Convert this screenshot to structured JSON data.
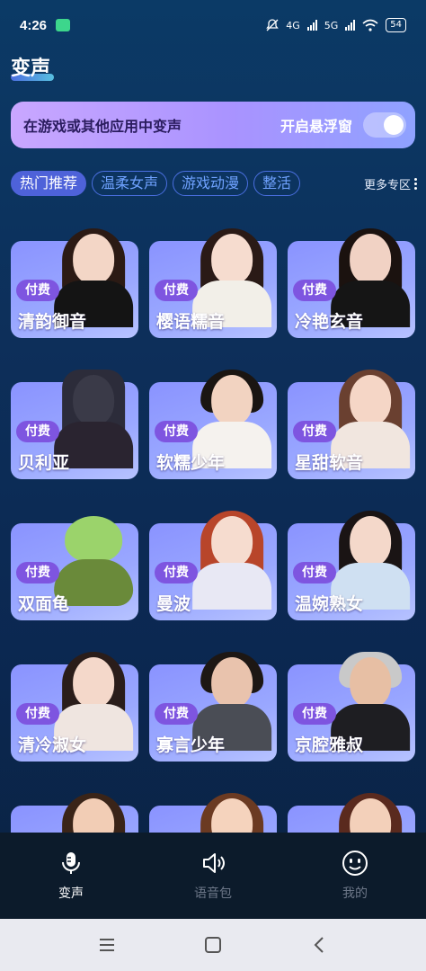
{
  "status_bar": {
    "time": "4:26",
    "signal_1": "4G",
    "signal_2": "5G",
    "battery": "54"
  },
  "header": {
    "title": "变声"
  },
  "float_banner": {
    "text": "在游戏或其他应用中变声",
    "toggle_label": "开启悬浮窗",
    "toggle_on": false
  },
  "tabs": {
    "items": [
      "热门推荐",
      "温柔女声",
      "游戏动漫",
      "整活"
    ],
    "active": "热门推荐",
    "more_label": "更多专区"
  },
  "voices": [
    {
      "name": "清韵御音",
      "badge": "付费"
    },
    {
      "name": "樱语糯音",
      "badge": "付费"
    },
    {
      "name": "冷艳玄音",
      "badge": "付费"
    },
    {
      "name": "贝利亚",
      "badge": "付费"
    },
    {
      "name": "软糯少年",
      "badge": "付费"
    },
    {
      "name": "星甜软音",
      "badge": "付费"
    },
    {
      "name": "双面龟",
      "badge": "付费"
    },
    {
      "name": "曼波",
      "badge": "付费"
    },
    {
      "name": "温婉熟女",
      "badge": "付费"
    },
    {
      "name": "清冷淑女",
      "badge": "付费"
    },
    {
      "name": "寡言少年",
      "badge": "付费"
    },
    {
      "name": "京腔雅叔",
      "badge": "付费"
    }
  ],
  "bottom_nav": {
    "items": [
      {
        "label": "变声",
        "icon": "microphone-icon",
        "active": true
      },
      {
        "label": "语音包",
        "icon": "speaker-icon",
        "active": false
      },
      {
        "label": "我的",
        "icon": "smiley-icon",
        "active": false
      }
    ]
  },
  "colors": {
    "accent": "#4e62d9",
    "badge": "#7e55e0",
    "banner_start": "#c9a7ff",
    "banner_end": "#8fa2ff"
  }
}
